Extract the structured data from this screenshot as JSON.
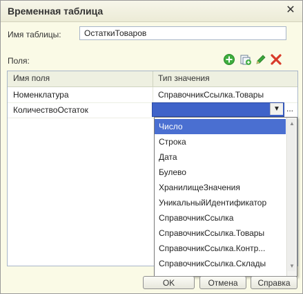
{
  "window": {
    "title": "Временная таблица",
    "close_symbol": "✕"
  },
  "form": {
    "table_name_label": "Имя таблицы:",
    "table_name_value": "ОстаткиТоваров",
    "fields_label": "Поля:"
  },
  "toolbar": {
    "icons": [
      "add-icon",
      "copy-icon",
      "edit-icon",
      "delete-icon"
    ],
    "add_color": "#3fae3f",
    "delete_color": "#d83a2a"
  },
  "grid": {
    "columns": [
      "Имя поля",
      "Тип значения"
    ],
    "rows": [
      {
        "name": "Номенклатура",
        "type": "СправочникСсылка.Товары"
      },
      {
        "name": "КоличествоОстаток",
        "type": ""
      }
    ]
  },
  "editor": {
    "dropdown_arrow": "▼",
    "ellipsis": "...",
    "options": [
      "Число",
      "Строка",
      "Дата",
      "Булево",
      "ХранилищеЗначения",
      "УникальныйИдентификатор",
      "СправочникСсылка",
      "СправочникСсылка.Товары",
      "СправочникСсылка.Контр...",
      "СправочникСсылка.Склады"
    ],
    "selected_index": 0,
    "selection_color": "#4a6fd1"
  },
  "buttons": {
    "ok": "OK",
    "cancel": "Отмена",
    "help": "Справка"
  }
}
